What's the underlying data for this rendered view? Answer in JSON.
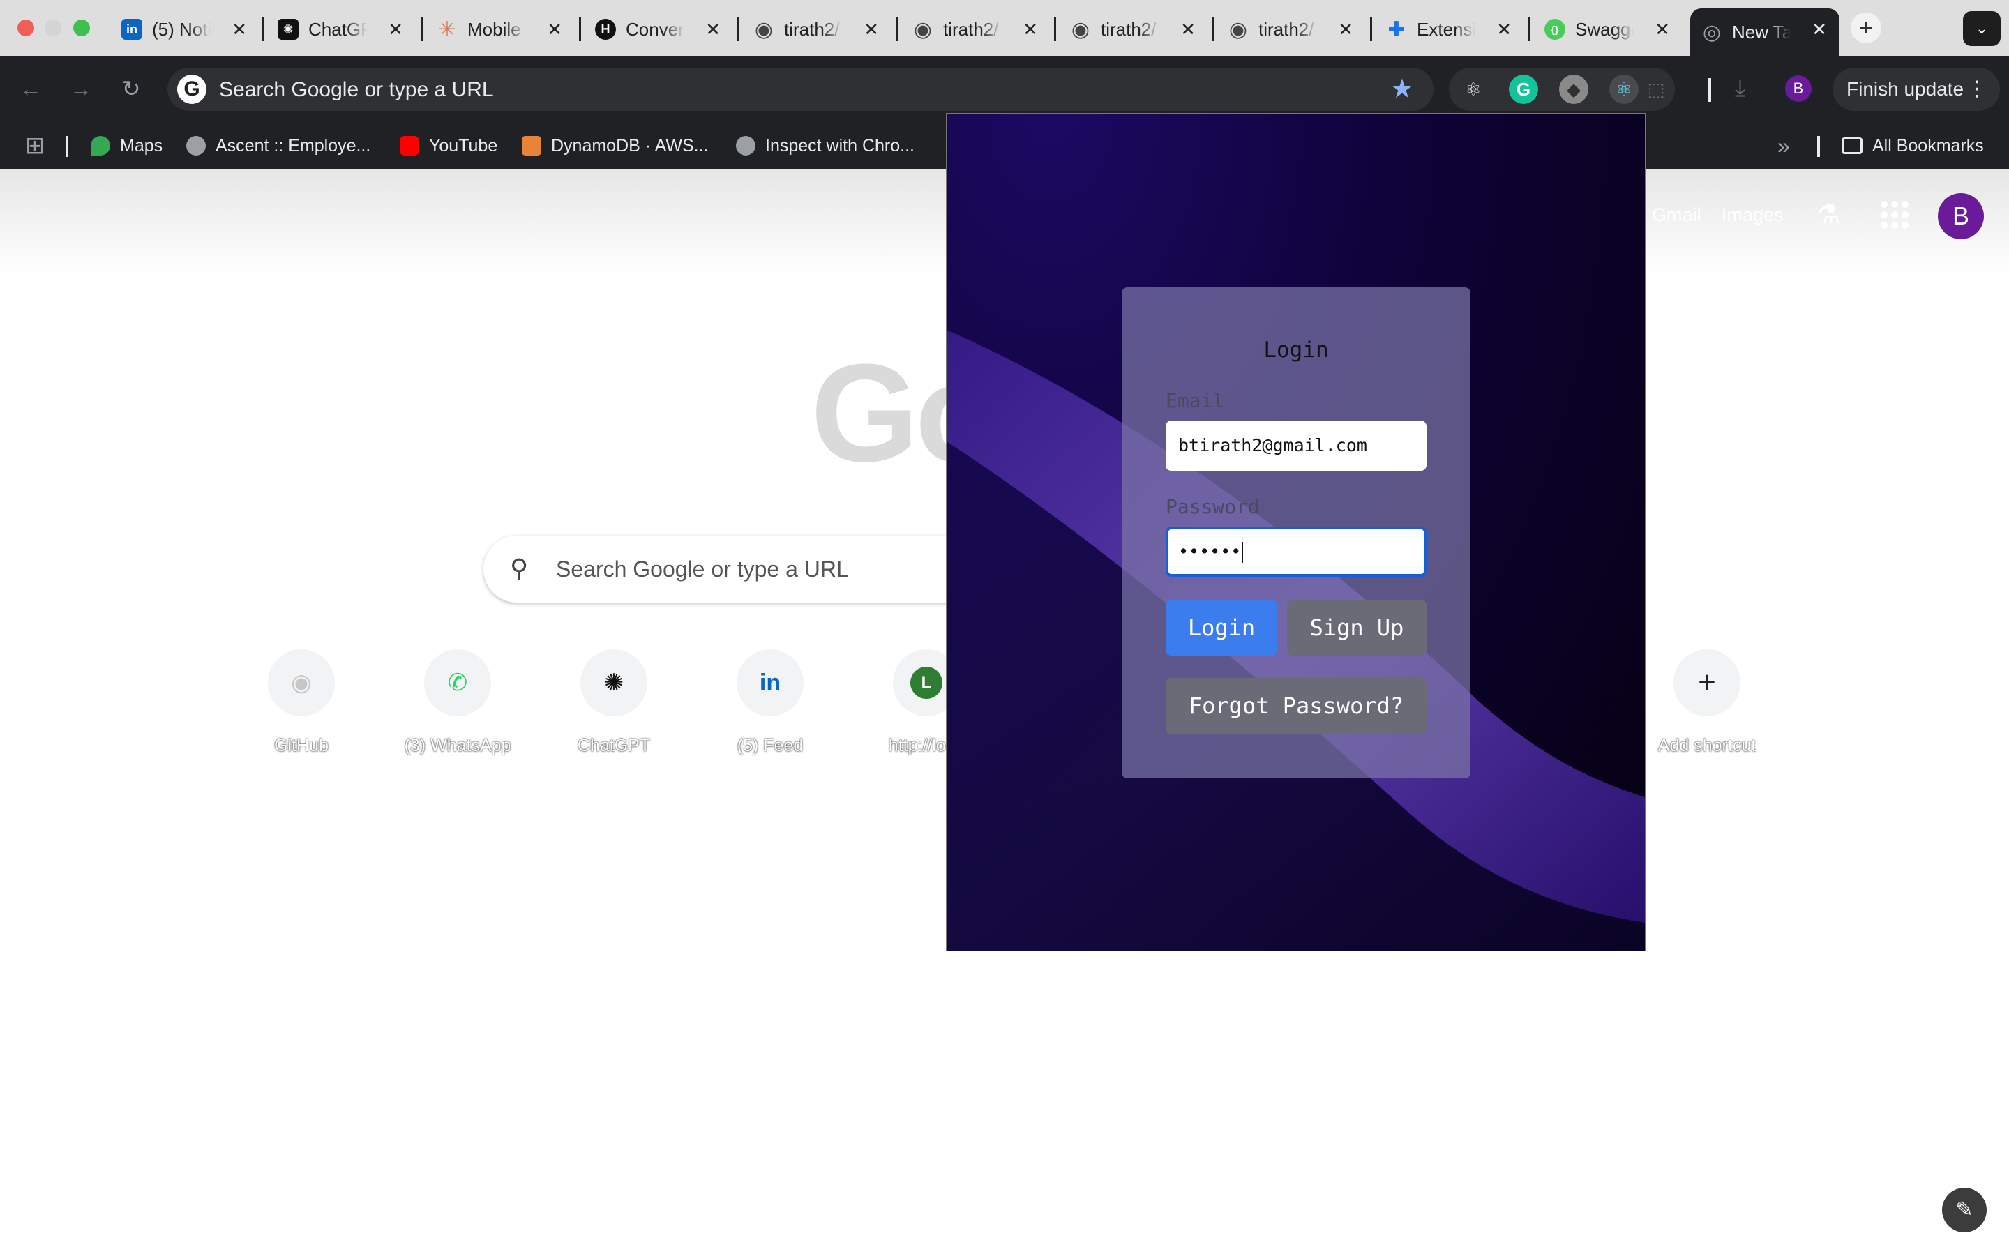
{
  "browser": {
    "tabs": [
      {
        "title": "(5) Noti",
        "icon": "linkedin-icon",
        "icon_color": "#0a66c2",
        "icon_glyph": "in"
      },
      {
        "title": "ChatGP",
        "icon": "chatgpt-icon",
        "icon_color": "#111111",
        "icon_glyph": "✺"
      },
      {
        "title": "Mobile I",
        "icon": "claude-icon",
        "icon_color": "#d97757",
        "icon_glyph": "✳"
      },
      {
        "title": "Conver",
        "icon": "hashnode-icon",
        "icon_color": "#111111",
        "icon_glyph": "H"
      },
      {
        "title": "tirath2/",
        "icon": "github-icon",
        "icon_color": "#444444",
        "icon_glyph": "◉"
      },
      {
        "title": "tirath2/",
        "icon": "github-icon",
        "icon_color": "#444444",
        "icon_glyph": "◉"
      },
      {
        "title": "tirath2/",
        "icon": "github-icon",
        "icon_color": "#444444",
        "icon_glyph": "◉"
      },
      {
        "title": "tirath2/",
        "icon": "github-icon",
        "icon_color": "#444444",
        "icon_glyph": "◉"
      },
      {
        "title": "Extensi",
        "icon": "puzzle-icon",
        "icon_color": "#1a73e8",
        "icon_glyph": "✚"
      },
      {
        "title": "Swagge",
        "icon": "swagger-icon",
        "icon_color": "#49cc5c",
        "icon_glyph": "{}"
      },
      {
        "title": "New Ta",
        "icon": "chrome-icon",
        "icon_color": "#5f6368",
        "icon_glyph": "◎"
      }
    ],
    "new_tab_symbol": "+",
    "tab_search_symbol": "⌄",
    "close_symbol": "✕",
    "omnibox": {
      "placeholder": "Search Google or type a URL",
      "engine_glyph": "G",
      "star": "★"
    },
    "nav": {
      "back": "←",
      "forward": "→",
      "reload": "↻"
    },
    "finish_update": "Finish update",
    "kebab": "⋮",
    "profile_initial": "B",
    "download_glyph": "⤓"
  },
  "bookmarks": {
    "apps_glyph": "⊞",
    "items": [
      {
        "label": "Maps",
        "color": "#34a853"
      },
      {
        "label": "Ascent :: Employe...",
        "color": "#9aa0a6"
      },
      {
        "label": "YouTube",
        "color": "#ff0000"
      },
      {
        "label": "DynamoDB · AWS...",
        "color": "#e8833a"
      },
      {
        "label": "Inspect with Chro...",
        "color": "#9aa0a6"
      }
    ],
    "overflow": "»",
    "all_bookmarks": "All Bookmarks"
  },
  "ntp": {
    "links": {
      "gmail": "Gmail",
      "images": "Images"
    },
    "labs_glyph": "⚗",
    "account_initial": "B",
    "logo_partial": "Go",
    "search_placeholder": "Search Google or type a URL",
    "search_glyph": "⚲",
    "shortcuts": [
      {
        "label": "GitHub",
        "glyph": "◉",
        "color": "#c7c7c7"
      },
      {
        "label": "(3) WhatsApp",
        "glyph": "✆",
        "color": "#25d366"
      },
      {
        "label": "ChatGPT",
        "glyph": "✺",
        "color": "#111111"
      },
      {
        "label": "(5) Feed",
        "glyph": "in",
        "color": "#0a66c2"
      },
      {
        "label": "http://loca",
        "glyph": "L",
        "color": "#2e7d32"
      },
      {
        "label": "Add shortcut",
        "glyph": "+",
        "color": "#222222"
      }
    ],
    "edit_glyph": "✎"
  },
  "popup": {
    "title": "Login",
    "email_label": "Email",
    "email_value": "btirath2@gmail.com",
    "password_label": "Password",
    "password_value": "••••••",
    "login_button": "Login",
    "signup_button": "Sign Up",
    "forgot_button": "Forgot Password?"
  }
}
